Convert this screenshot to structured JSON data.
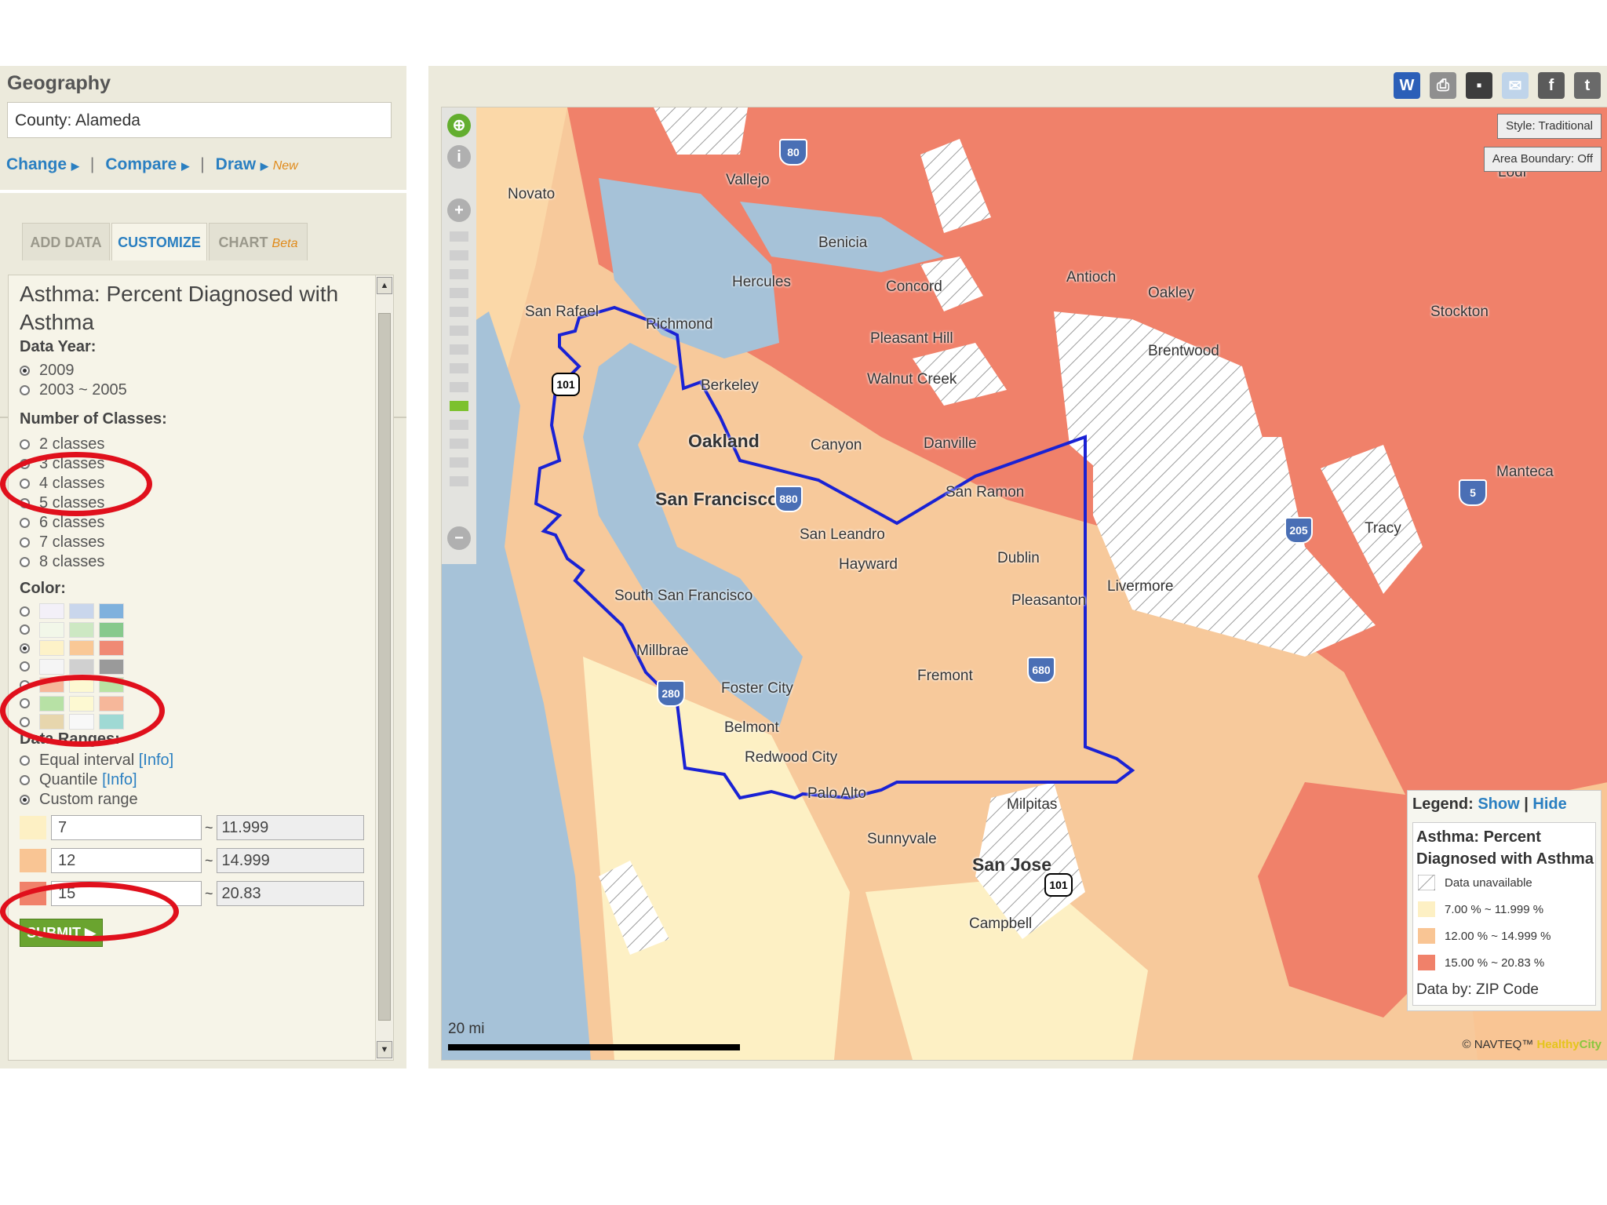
{
  "geography": {
    "title": "Geography",
    "value": "County: Alameda",
    "links": {
      "change": "Change",
      "compare": "Compare",
      "draw": "Draw",
      "new_badge": "New",
      "separator": "|"
    }
  },
  "tabs": {
    "add_data": "ADD DATA",
    "customize": "CUSTOMIZE",
    "chart": "CHART",
    "chart_badge": "Beta"
  },
  "customize": {
    "layer_title": "Asthma: Percent Diagnosed with Asthma",
    "data_year_label": "Data Year:",
    "years": [
      "2009",
      "2003 ~ 2005"
    ],
    "selected_year": "2009",
    "classes_label": "Number of Classes:",
    "classes": [
      "2 classes",
      "3 classes",
      "4 classes",
      "5 classes",
      "6 classes",
      "7 classes",
      "8 classes"
    ],
    "selected_classes": "3 classes",
    "color_label": "Color:",
    "color_schemes": [
      [
        "#f3f0f8",
        "#c9d6ec",
        "#7fb1dd"
      ],
      [
        "#f2f7e9",
        "#cde8c3",
        "#87c98c"
      ],
      [
        "#fdf2c8",
        "#f9c896",
        "#f08a74"
      ],
      [
        "#f5f5f5",
        "#d0d0d0",
        "#9a9a9a"
      ],
      [
        "#f6b79a",
        "#fdf9d2",
        "#b9e3a3"
      ],
      [
        "#b7e1a5",
        "#fdf9d2",
        "#f6b79a"
      ],
      [
        "#e7d6ad",
        "#f8f8f8",
        "#9fd9d4"
      ]
    ],
    "selected_color_index": 2,
    "ranges_label": "Data Ranges:",
    "range_methods": [
      "Equal interval",
      "Quantile",
      "Custom range"
    ],
    "info_link": "[Info]",
    "selected_range_method": "Custom range",
    "ranges": [
      {
        "min": "7",
        "max": "11.999",
        "color": "#fdf0c4"
      },
      {
        "min": "12",
        "max": "14.999",
        "color": "#f9c594"
      },
      {
        "min": "15",
        "max": "20.83",
        "color": "#f0816a"
      }
    ],
    "range_separator": "~",
    "submit_label": "SUBMIT"
  },
  "map": {
    "toolbar_icons": [
      "word-icon",
      "print-icon",
      "save-icon",
      "email-icon",
      "facebook-icon",
      "twitter-icon"
    ],
    "style_button": "Style: Traditional",
    "boundary_button": "Area Boundary: Off",
    "places": [
      "Novato",
      "Vallejo",
      "Benicia",
      "Hercules",
      "Concord",
      "Antioch",
      "Oakley",
      "Stockton",
      "San Rafael",
      "Richmond",
      "Pleasant Hill",
      "Brentwood",
      "Walnut Creek",
      "Berkeley",
      "Oakland",
      "Canyon",
      "Danville",
      "San Francisco",
      "San Ramon",
      "San Leandro",
      "Hayward",
      "Dublin",
      "Livermore",
      "Pleasanton",
      "Tracy",
      "Manteca",
      "South San Francisco",
      "Millbrae",
      "Foster City",
      "Fremont",
      "Belmont",
      "Redwood City",
      "Palo Alto",
      "Milpitas",
      "Sunnyvale",
      "San Jose",
      "Campbell",
      "Lodi"
    ],
    "highways": [
      "80",
      "101",
      "880",
      "205",
      "5",
      "680",
      "280",
      "101"
    ],
    "scale_label": "20 mi",
    "credit_provider": "© NAVTEQ™",
    "credit_brand_a": "Healthy",
    "credit_brand_b": "City"
  },
  "legend": {
    "label": "Legend:",
    "show": "Show",
    "hide": "Hide",
    "separator": "|",
    "title": "Asthma: Percent Diagnosed with Asthma",
    "items": [
      {
        "label": "Data unavailable",
        "color": "hatched"
      },
      {
        "label": "7.00 % ~ 11.999 %",
        "color": "#fdf0c4"
      },
      {
        "label": "12.00 % ~ 14.999 %",
        "color": "#f9c594"
      },
      {
        "label": "15.00 % ~ 20.83 %",
        "color": "#f0816a"
      }
    ],
    "note": "Data by: ZIP Code"
  },
  "colors": {
    "accent": "#2a7fc1",
    "water": "#a6c2d8",
    "boundary": "#1a22d4",
    "annotation": "#e0101c"
  }
}
